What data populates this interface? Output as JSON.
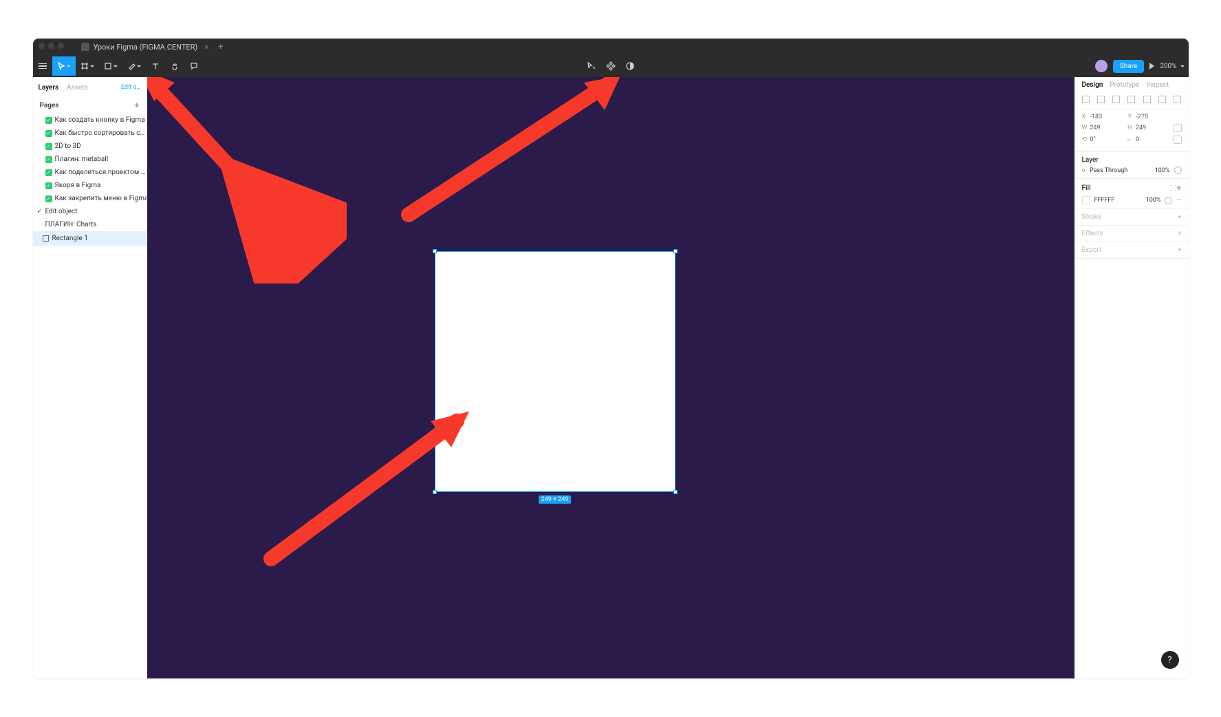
{
  "titlebar": {
    "filename": "Уроки Figma (FIGMA.CENTER)",
    "close": "×",
    "new_tab": "+"
  },
  "toolbar_tooltip": "Edit object",
  "share": "Share",
  "zoom": "200%",
  "left_panel": {
    "tabs": {
      "layers": "Layers",
      "assets": "Assets",
      "link": "Edit o…"
    },
    "pages_label": "Pages",
    "pages": [
      "Как создать кнопку в Figma",
      "Как быстро сортировать с…",
      "2D to 3D",
      "Плагин: metaball",
      "Как поделиться проектом …",
      "Якоря в Figma",
      "Как закрепить меню в Figma",
      "Edit object",
      "ПЛАГИН: Charts"
    ],
    "selected_layer": "Rectangle 1"
  },
  "right_panel": {
    "tabs": {
      "design": "Design",
      "prototype": "Prototype",
      "inspect": "Inspect"
    },
    "x": "-183",
    "y": "-275",
    "w": "249",
    "h": "249",
    "rot": "0°",
    "rad": "0",
    "layer_label": "Layer",
    "blend": "Pass Through",
    "blend_pct": "100%",
    "fill_label": "Fill",
    "fill_hex": "FFFFFF",
    "fill_pct": "100%",
    "stroke_label": "Stroke",
    "effects_label": "Effects",
    "export_label": "Export"
  },
  "canvas": {
    "size_badge": "249 × 249"
  },
  "help": "?"
}
